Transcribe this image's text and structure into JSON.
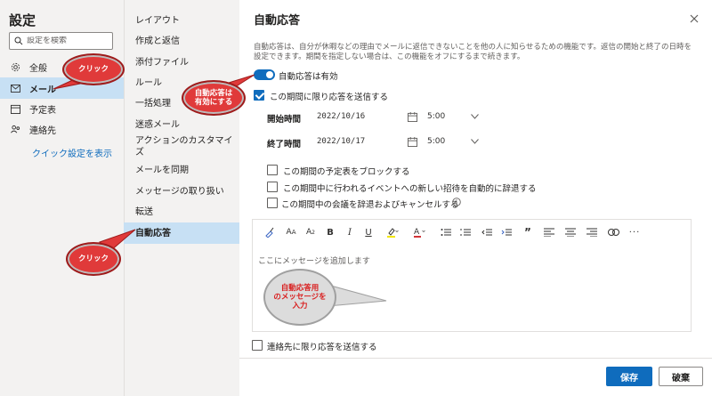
{
  "settings": {
    "title": "設定",
    "search_placeholder": "設定を検索"
  },
  "nav1": {
    "items": [
      {
        "label": "全般",
        "icon": "gear-icon"
      },
      {
        "label": "メール",
        "icon": "mail-icon"
      },
      {
        "label": "予定表",
        "icon": "calendar-icon"
      },
      {
        "label": "連絡先",
        "icon": "people-icon"
      }
    ],
    "quick_settings": "クイック設定を表示"
  },
  "nav2": {
    "items": [
      "レイアウト",
      "作成と返信",
      "添付ファイル",
      "ルール",
      "一括処理",
      "迷惑メール",
      "アクションのカスタマイズ",
      "メールを同期",
      "メッセージの取り扱い",
      "転送",
      "自動応答"
    ]
  },
  "pane": {
    "title": "自動応答",
    "description": "自動応答は、自分が休暇などの理由でメールに返信できないことを他の人に知らせるための機能です。返信の開始と終了の日時を設定できます。期間を指定しない場合は、この機能をオフにするまで続きます。",
    "toggle_label": "自動応答は有効",
    "period_checkbox_label": "この期間に限り応答を送信する",
    "start_label": "開始時間",
    "start_date": "2022/10/16",
    "start_time": "5:00",
    "end_label": "終了時間",
    "end_date": "2022/10/17",
    "end_time": "5:00",
    "option_block_calendar": "この期間の予定表をブロックする",
    "option_decline_invites": "この期間中に行われるイベントへの新しい招待を自動的に辞退する",
    "option_decline_cancel": "この期間中の会議を辞退およびキャンセルする",
    "editor_placeholder": "ここにメッセージを追加します",
    "contacts_only_label": "連絡先に限り応答を送信する",
    "save_label": "保存",
    "discard_label": "破棄"
  },
  "annotations": {
    "click1": "クリック",
    "click2": "クリック",
    "enable_line1": "自動応答は",
    "enable_line2": "有効にする",
    "message_line1": "自動応答用",
    "message_line2": "のメッセージを",
    "message_line3": "入力"
  },
  "colors": {
    "accent": "#0f6cbd",
    "selected": "#c7e0f4",
    "annotation_red": "#e03a3a"
  }
}
